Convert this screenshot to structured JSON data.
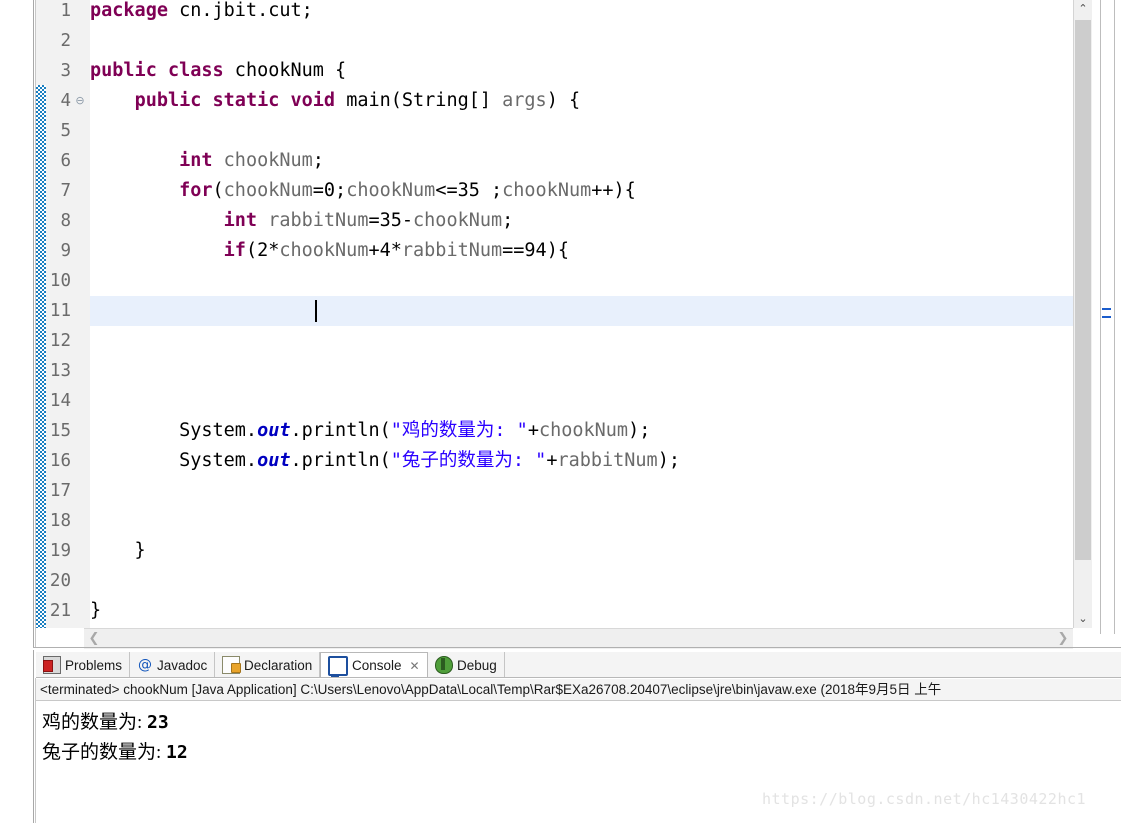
{
  "editor": {
    "lines": [
      {
        "num": "1",
        "fold": "",
        "tokens": [
          {
            "t": "package",
            "c": "kw"
          },
          {
            "t": " ",
            "c": "plain"
          },
          {
            "t": "cn.jbit.cut;",
            "c": "plain"
          }
        ]
      },
      {
        "num": "2",
        "fold": "",
        "tokens": []
      },
      {
        "num": "3",
        "fold": "",
        "tokens": [
          {
            "t": "public",
            "c": "kw"
          },
          {
            "t": " ",
            "c": "plain"
          },
          {
            "t": "class",
            "c": "kw"
          },
          {
            "t": " chookNum {",
            "c": "plain"
          }
        ]
      },
      {
        "num": "4",
        "fold": "⊖",
        "tokens": [
          {
            "t": "    ",
            "c": "plain"
          },
          {
            "t": "public",
            "c": "kw"
          },
          {
            "t": " ",
            "c": "plain"
          },
          {
            "t": "static",
            "c": "kw"
          },
          {
            "t": " ",
            "c": "plain"
          },
          {
            "t": "void",
            "c": "kw"
          },
          {
            "t": " main(String[] ",
            "c": "plain"
          },
          {
            "t": "args",
            "c": "ident"
          },
          {
            "t": ") {",
            "c": "plain"
          }
        ]
      },
      {
        "num": "5",
        "fold": "",
        "tokens": []
      },
      {
        "num": "6",
        "fold": "",
        "tokens": [
          {
            "t": "        ",
            "c": "plain"
          },
          {
            "t": "int",
            "c": "kw"
          },
          {
            "t": " ",
            "c": "plain"
          },
          {
            "t": "chookNum",
            "c": "ident"
          },
          {
            "t": ";",
            "c": "plain"
          }
        ]
      },
      {
        "num": "7",
        "fold": "",
        "tokens": [
          {
            "t": "        ",
            "c": "plain"
          },
          {
            "t": "for",
            "c": "kw"
          },
          {
            "t": "(",
            "c": "plain"
          },
          {
            "t": "chookNum",
            "c": "ident"
          },
          {
            "t": "=0;",
            "c": "plain"
          },
          {
            "t": "chookNum",
            "c": "ident"
          },
          {
            "t": "<=35 ;",
            "c": "plain"
          },
          {
            "t": "chookNum",
            "c": "ident"
          },
          {
            "t": "++){",
            "c": "plain"
          }
        ]
      },
      {
        "num": "8",
        "fold": "",
        "tokens": [
          {
            "t": "            ",
            "c": "plain"
          },
          {
            "t": "int",
            "c": "kw"
          },
          {
            "t": " ",
            "c": "plain"
          },
          {
            "t": "rabbitNum",
            "c": "ident"
          },
          {
            "t": "=35-",
            "c": "plain"
          },
          {
            "t": "chookNum",
            "c": "ident"
          },
          {
            "t": ";",
            "c": "plain"
          }
        ]
      },
      {
        "num": "9",
        "fold": "",
        "tokens": [
          {
            "t": "            ",
            "c": "plain"
          },
          {
            "t": "if",
            "c": "kw"
          },
          {
            "t": "(2*",
            "c": "plain"
          },
          {
            "t": "chookNum",
            "c": "ident"
          },
          {
            "t": "+4*",
            "c": "plain"
          },
          {
            "t": "rabbitNum",
            "c": "ident"
          },
          {
            "t": "==94){",
            "c": "plain"
          }
        ]
      },
      {
        "num": "10",
        "fold": "",
        "tokens": []
      },
      {
        "num": "11",
        "fold": "",
        "tokens": [],
        "current": true
      },
      {
        "num": "12",
        "fold": "",
        "tokens": []
      },
      {
        "num": "13",
        "fold": "",
        "tokens": []
      },
      {
        "num": "14",
        "fold": "",
        "tokens": []
      },
      {
        "num": "15",
        "fold": "",
        "tokens": [
          {
            "t": "        System.",
            "c": "plain"
          },
          {
            "t": "out",
            "c": "field"
          },
          {
            "t": ".println(",
            "c": "plain"
          },
          {
            "t": "\"鸡的数量为: \"",
            "c": "str"
          },
          {
            "t": "+",
            "c": "plain"
          },
          {
            "t": "chookNum",
            "c": "ident"
          },
          {
            "t": ");",
            "c": "plain"
          }
        ]
      },
      {
        "num": "16",
        "fold": "",
        "tokens": [
          {
            "t": "        System.",
            "c": "plain"
          },
          {
            "t": "out",
            "c": "field"
          },
          {
            "t": ".println(",
            "c": "plain"
          },
          {
            "t": "\"兔子的数量为: \"",
            "c": "str"
          },
          {
            "t": "+",
            "c": "plain"
          },
          {
            "t": "rabbitNum",
            "c": "ident"
          },
          {
            "t": ");",
            "c": "plain"
          }
        ]
      },
      {
        "num": "17",
        "fold": "",
        "tokens": []
      },
      {
        "num": "18",
        "fold": "",
        "tokens": []
      },
      {
        "num": "19",
        "fold": "",
        "tokens": [
          {
            "t": "    }",
            "c": "plain"
          }
        ]
      },
      {
        "num": "20",
        "fold": "",
        "tokens": []
      },
      {
        "num": "21",
        "fold": "",
        "tokens": [
          {
            "t": "}",
            "c": "plain"
          }
        ]
      }
    ],
    "scrollbar": {
      "up_arrow": "⌃",
      "down_arrow": "⌄",
      "left_arrow": "❮",
      "right_arrow": "❯"
    }
  },
  "panel": {
    "tabs": [
      {
        "label": "Problems",
        "icon": "problems-icon",
        "active": false,
        "closable": false
      },
      {
        "label": "Javadoc",
        "icon": "at-icon",
        "active": false,
        "closable": false
      },
      {
        "label": "Declaration",
        "icon": "declaration-icon",
        "active": false,
        "closable": false
      },
      {
        "label": "Console",
        "icon": "console-icon",
        "active": true,
        "closable": true
      },
      {
        "label": "Debug",
        "icon": "bug-icon",
        "active": false,
        "closable": false
      }
    ],
    "close_glyph": "✕",
    "terminated_line": "<terminated> chookNum [Java Application] C:\\Users\\Lenovo\\AppData\\Local\\Temp\\Rar$EXa26708.20407\\eclipse\\jre\\bin\\javaw.exe (2018年9月5日 上午",
    "output": [
      {
        "text": "鸡的数量为: ",
        "value": "23"
      },
      {
        "text": "兔子的数量为: ",
        "value": "12"
      }
    ]
  },
  "watermark": "https://blog.csdn.net/hc1430422hc1",
  "colors": {
    "keyword": "#7f0055",
    "string": "#2a00ff",
    "field": "#0000c0",
    "identifier": "#6a6a6a",
    "current_line": "#e8f0fc",
    "change_bar": "#1a7fc1"
  }
}
